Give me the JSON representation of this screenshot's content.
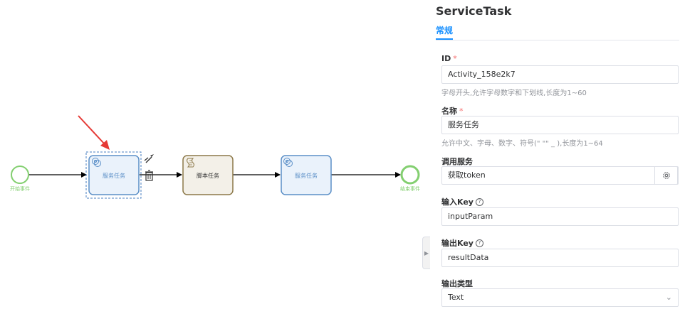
{
  "canvas": {
    "start_event_label": "开始事件",
    "end_event_label": "结束事件",
    "nodes": {
      "service_task_1": "服务任务",
      "script_task": "脚本任务",
      "service_task_2": "服务任务"
    }
  },
  "panel": {
    "title": "ServiceTask",
    "tab_general": "常规",
    "fields": {
      "id": {
        "label": "ID",
        "required_mark": "*",
        "value": "Activity_158e2k7",
        "hint": "字母开头,允许字母数字和下划线,长度为1~60"
      },
      "name": {
        "label": "名称",
        "required_mark": "*",
        "value": "服务任务",
        "hint": "允许中文、字母、数字、符号(\" \"\" _ ),长度为1~64"
      },
      "call_service": {
        "label": "调用服务",
        "value": "获取token"
      },
      "input_key": {
        "label": "输入Key",
        "value": "inputParam"
      },
      "output_key": {
        "label": "输出Key",
        "value": "resultData"
      },
      "output_type": {
        "label": "输出类型",
        "value": "Text"
      }
    }
  },
  "icons": {
    "service_gear": "gear-icon",
    "script": "script-icon",
    "append_arrow": "append-arrow-icon",
    "delete": "trash-icon",
    "settings": "gear-icon",
    "help": "question-circle-icon",
    "select_arrow": "chevron-down-icon",
    "collapse": "caret-right-icon"
  },
  "colors": {
    "accent": "#1890ff",
    "start_event": "#83cf70",
    "end_event": "#83cf70",
    "service_task_stroke": "#5b8fc7",
    "service_task_fill": "#eaf2fb",
    "script_task_stroke": "#8c7848",
    "script_task_fill": "#f3f0e8",
    "annotation_arrow": "#e53935",
    "required": "#f56c6c"
  }
}
